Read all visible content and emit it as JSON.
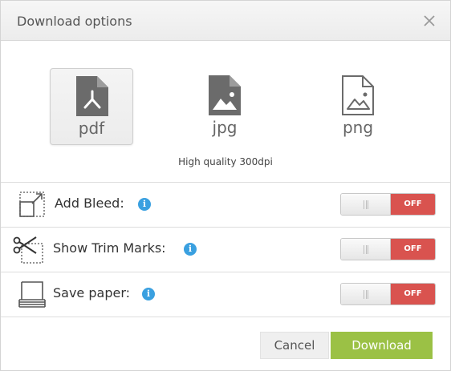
{
  "dialog": {
    "title": "Download options",
    "close_icon": "close-icon"
  },
  "formats": {
    "items": [
      {
        "label": "pdf",
        "icon": "pdf-file-icon",
        "selected": true
      },
      {
        "label": "jpg",
        "icon": "image-file-icon",
        "selected": false
      },
      {
        "label": "png",
        "icon": "image-file-outline-icon",
        "selected": false
      }
    ],
    "quality_note": "High quality 300dpi"
  },
  "options": [
    {
      "label": "Add Bleed:",
      "icon": "bleed-icon",
      "info_icon": "info-icon",
      "toggle_state": "OFF"
    },
    {
      "label": "Show Trim Marks:",
      "icon": "scissors-trim-icon",
      "info_icon": "info-icon",
      "toggle_state": "OFF"
    },
    {
      "label": "Save paper:",
      "icon": "paper-stack-icon",
      "info_icon": "info-icon",
      "toggle_state": "OFF"
    }
  ],
  "footer": {
    "cancel_label": "Cancel",
    "download_label": "Download"
  },
  "colors": {
    "accent_green": "#9bc145",
    "toggle_off_red": "#d9534f",
    "info_blue": "#3aa0e0",
    "icon_gray": "#6b6b6b"
  }
}
